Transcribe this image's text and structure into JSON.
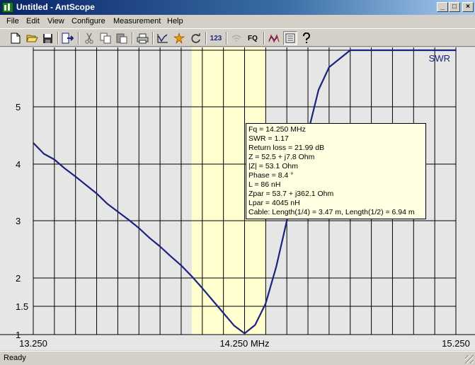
{
  "window": {
    "title": "Untitled - AntScope",
    "minimize_glyph": "_",
    "maximize_glyph": "□",
    "close_glyph": "×"
  },
  "menu": [
    "File",
    "Edit",
    "View",
    "Configure",
    "Measurement",
    "Help"
  ],
  "toolbar": {
    "buttons": [
      "new-file",
      "open-folder",
      "save-disk",
      "export",
      "cut-scissors",
      "copy",
      "paste",
      "print",
      "plot-swr",
      "star-burst",
      "refresh",
      "numeric-123",
      "wireless",
      "frequency-fq",
      "dual-graph",
      "list-view",
      "help-question"
    ],
    "text_123": "123",
    "text_fq": "FQ"
  },
  "chart_data": {
    "type": "line",
    "series": [
      {
        "name": "SWR",
        "color": "#1a237e",
        "x": [
          13.25,
          13.3,
          13.35,
          13.4,
          13.45,
          13.5,
          13.55,
          13.6,
          13.65,
          13.7,
          13.75,
          13.8,
          13.85,
          13.9,
          13.95,
          14.0,
          14.05,
          14.1,
          14.15,
          14.2,
          14.25,
          14.3,
          14.35,
          14.4,
          14.45,
          14.5,
          14.55,
          14.6,
          14.65,
          14.7,
          14.75,
          14.8,
          14.85,
          14.9,
          14.95,
          15.0,
          15.05,
          15.1,
          15.15,
          15.2,
          15.25
        ],
        "y": [
          4.37,
          4.18,
          4.08,
          3.92,
          3.78,
          3.63,
          3.48,
          3.3,
          3.16,
          3.02,
          2.87,
          2.7,
          2.55,
          2.38,
          2.22,
          2.03,
          1.82,
          1.6,
          1.38,
          1.16,
          1.02,
          1.17,
          1.55,
          2.2,
          3.0,
          3.8,
          4.55,
          5.3,
          5.7,
          5.85,
          6.0,
          6.0,
          6.0,
          6.0,
          6.0,
          6.0,
          6.0,
          6.0,
          6.0,
          6.0,
          6.0
        ]
      }
    ],
    "x_ticks": [
      "13.250",
      "14.250 MHz",
      "15.250"
    ],
    "y_ticks": [
      "1",
      "1.5",
      "2",
      "3",
      "4",
      "5"
    ],
    "xlim": [
      13.25,
      15.25
    ],
    "ylim": [
      1,
      6
    ],
    "band_highlight": [
      14.0,
      14.35
    ],
    "grid": true,
    "legend": "SWR"
  },
  "tooltip": [
    "Fq = 14.250 MHz",
    "SWR = 1.17",
    "Return loss = 21.99 dB",
    "Z = 52.5 + j7.8 Ohm",
    "|Z| = 53.1 Ohm",
    "Phase = 8.4 °",
    "L = 86 nH",
    "Zpar = 53.7 + j362.1 Ohm",
    "Lpar = 4045 nH",
    "Cable: Length(1/4) = 3.47 m, Length(1/2) = 6.94 m"
  ],
  "status": "Ready"
}
